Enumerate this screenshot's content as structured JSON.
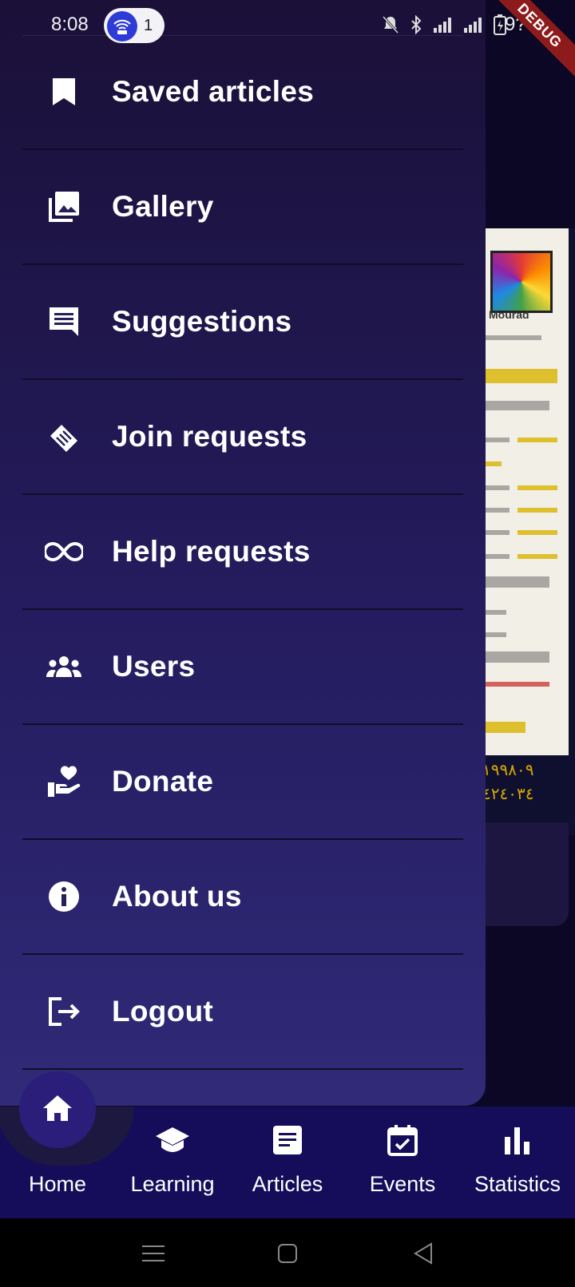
{
  "status_bar": {
    "time": "8:08",
    "notification_count": "1",
    "battery": "9?%",
    "debug_label": "DEBUG"
  },
  "drawer": {
    "items": [
      {
        "label": "Saved articles",
        "icon": "bookmark-icon"
      },
      {
        "label": "Gallery",
        "icon": "gallery-icon"
      },
      {
        "label": "Suggestions",
        "icon": "message-icon"
      },
      {
        "label": "Join requests",
        "icon": "handshake-icon"
      },
      {
        "label": "Help requests",
        "icon": "infinity-icon"
      },
      {
        "label": "Users",
        "icon": "users-icon"
      },
      {
        "label": "Donate",
        "icon": "donate-icon"
      },
      {
        "label": "About us",
        "icon": "info-icon"
      },
      {
        "label": "Logout",
        "icon": "logout-icon"
      }
    ]
  },
  "background": {
    "banner_logo_text": "Mourad",
    "banner_footer": "١٩٩٨٠٩\n٤٢٤٠٣٤"
  },
  "bottom_nav": {
    "items": [
      {
        "label": "Home",
        "icon": "home-icon",
        "active": true
      },
      {
        "label": "Learning",
        "icon": "school-icon"
      },
      {
        "label": "Articles",
        "icon": "article-icon"
      },
      {
        "label": "Events",
        "icon": "event-icon"
      },
      {
        "label": "Statistics",
        "icon": "bar-chart-icon"
      }
    ]
  },
  "colors": {
    "drawer_top": "#1a1038",
    "drawer_bottom": "#302a78",
    "bottom_nav": "#150d5a",
    "fab": "#2a1e7a"
  }
}
